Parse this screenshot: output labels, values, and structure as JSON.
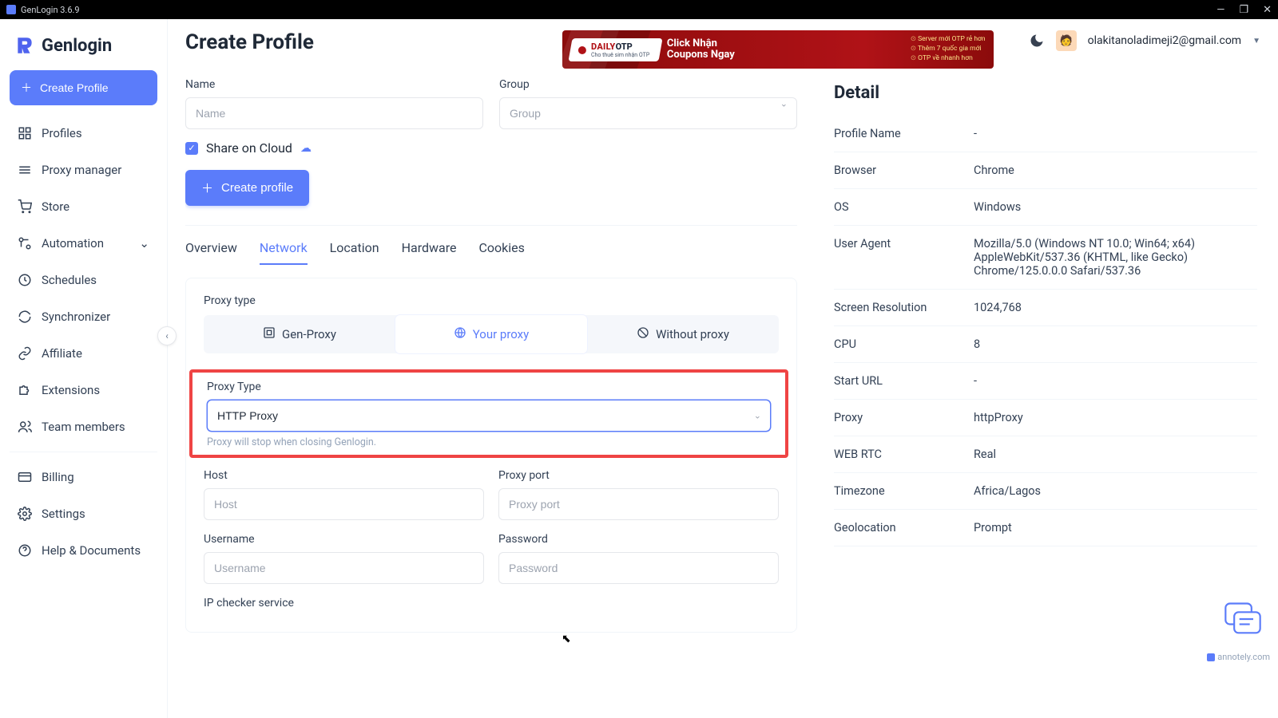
{
  "window": {
    "title": "GenLogin 3.6.9"
  },
  "brand": "Genlogin",
  "sidebar": {
    "create": "Create Profile",
    "items": [
      {
        "label": "Profiles",
        "icon": "grid"
      },
      {
        "label": "Proxy manager",
        "icon": "layers"
      },
      {
        "label": "Store",
        "icon": "cart"
      },
      {
        "label": "Automation",
        "icon": "nodes",
        "expand": true
      },
      {
        "label": "Schedules",
        "icon": "clock"
      },
      {
        "label": "Synchronizer",
        "icon": "refresh"
      },
      {
        "label": "Affiliate",
        "icon": "link"
      },
      {
        "label": "Extensions",
        "icon": "puzzle"
      },
      {
        "label": "Team members",
        "icon": "users"
      }
    ],
    "footer": [
      {
        "label": "Billing",
        "icon": "card"
      },
      {
        "label": "Settings",
        "icon": "gear"
      },
      {
        "label": "Help & Documents",
        "icon": "help"
      }
    ]
  },
  "header": {
    "title": "Create Profile",
    "banner": {
      "brand1": "DAILY",
      "brand2": "OTP",
      "brandSub": "Cho thuê sim nhận OTP",
      "line1": "Click Nhận",
      "line2": "Coupons Ngay",
      "r1": "Server mới OTP rẻ hơn",
      "r2": "Thêm 7 quốc gia mới",
      "r3": "OTP về nhanh hơn"
    },
    "user": "olakitanoladimeji2@gmail.com"
  },
  "form": {
    "nameLabel": "Name",
    "namePh": "Name",
    "groupLabel": "Group",
    "groupPh": "Group",
    "shareLabel": "Share on Cloud",
    "submit": "Create profile"
  },
  "tabs": [
    "Overview",
    "Network",
    "Location",
    "Hardware",
    "Cookies"
  ],
  "network": {
    "proxyTypeLabel": "Proxy type",
    "segs": [
      "Gen-Proxy",
      "Your proxy",
      "Without proxy"
    ],
    "proxyTypeField": "Proxy Type",
    "proxyTypeValue": "HTTP Proxy",
    "proxyHint": "Proxy will stop when closing Genlogin.",
    "hostLabel": "Host",
    "hostPh": "Host",
    "portLabel": "Proxy port",
    "portPh": "Proxy port",
    "userLabel": "Username",
    "userPh": "Username",
    "passLabel": "Password",
    "passPh": "Password",
    "ipLabel": "IP checker service"
  },
  "detail": {
    "title": "Detail",
    "rows": [
      {
        "k": "Profile Name",
        "v": "-"
      },
      {
        "k": "Browser",
        "v": "Chrome"
      },
      {
        "k": "OS",
        "v": "Windows"
      },
      {
        "k": "User Agent",
        "v": "Mozilla/5.0 (Windows NT 10.0; Win64; x64) AppleWebKit/537.36 (KHTML, like Gecko) Chrome/125.0.0.0 Safari/537.36"
      },
      {
        "k": "Screen Resolution",
        "v": "1024,768"
      },
      {
        "k": "CPU",
        "v": "8"
      },
      {
        "k": "Start URL",
        "v": "-"
      },
      {
        "k": "Proxy",
        "v": "httpProxy"
      },
      {
        "k": "WEB RTC",
        "v": "Real"
      },
      {
        "k": "Timezone",
        "v": "Africa/Lagos"
      },
      {
        "k": "Geolocation",
        "v": "Prompt"
      }
    ]
  },
  "annotely": "annotely.com"
}
